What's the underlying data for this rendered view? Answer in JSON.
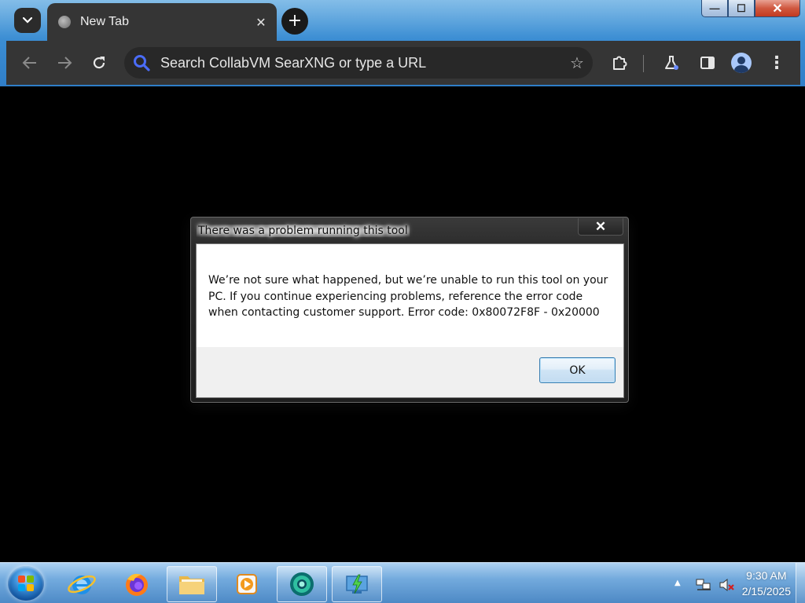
{
  "browser": {
    "tab": {
      "title": "New Tab",
      "close_glyph": "✕",
      "favicon": "globe-icon"
    },
    "tab_search_glyph": "⌄",
    "new_tab_glyph": "+",
    "window_controls": {
      "minimize_glyph": "—",
      "maximize_glyph": "☐",
      "close_glyph": "✕"
    },
    "toolbar": {
      "back_glyph": "←",
      "forward_glyph": "→",
      "reload_glyph": "↻",
      "omnibox_placeholder": "Search CollabVM SearXNG or type a URL",
      "bookmark_glyph": "☆",
      "extensions_icon": "puzzle-icon",
      "labs_icon": "flask-icon",
      "side_panel_icon": "side-panel-icon",
      "profile_icon": "avatar-icon",
      "menu_glyph": "⋮"
    },
    "colors": {
      "chrome_dark": "#353535",
      "omnibox_bg": "#282828",
      "search_icon_blue": "#4a6cf7"
    }
  },
  "dialog": {
    "title": "There was a problem running this tool",
    "close_glyph": "✕",
    "message": "We’re not sure what happened, but we’re unable to run this tool on your PC. If you continue experiencing problems, reference the error code when contacting customer support. Error code: 0x80072F8F - 0x20000",
    "ok_label": "OK"
  },
  "taskbar": {
    "apps": [
      {
        "name": "Internet Explorer",
        "icon": "internet-explorer-icon"
      },
      {
        "name": "Firefox",
        "icon": "firefox-icon"
      },
      {
        "name": "Windows Explorer",
        "icon": "folder-icon"
      },
      {
        "name": "Media Player",
        "icon": "media-player-icon"
      },
      {
        "name": "Chrome",
        "icon": "chrome-icon"
      },
      {
        "name": "Media Creation Tool",
        "icon": "media-creation-tool-icon"
      }
    ],
    "tray": {
      "show_hidden_glyph": "▲",
      "clock_time": "9:30 AM",
      "clock_date": "2/15/2025"
    }
  }
}
